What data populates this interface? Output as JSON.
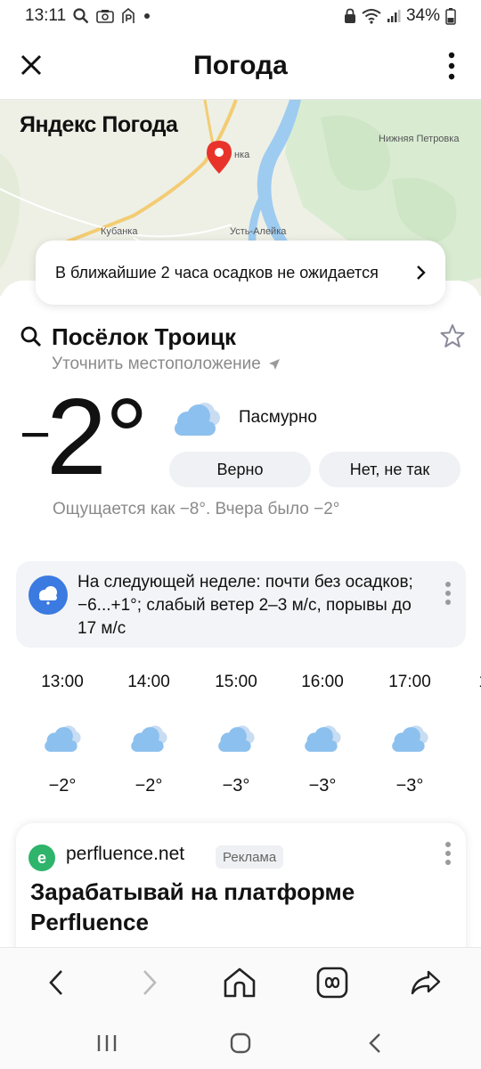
{
  "status": {
    "time": "13:11",
    "battery": "34%",
    "icons": [
      "search-icon",
      "screenshot-icon",
      "parking-icon",
      "dot-icon",
      "lock-icon",
      "wifi-icon",
      "signal-icon",
      "battery-icon"
    ]
  },
  "header": {
    "title": "Погода"
  },
  "map": {
    "brand": "Яндекс Погода",
    "labels": [
      "нка",
      "Нижняя Петровка",
      "Кубанка",
      "Усть-Алейка"
    ]
  },
  "precip": {
    "text": "В ближайшие 2 часа осадков не ожидается"
  },
  "location": {
    "name": "Посёлок Троицк",
    "refine": "Уточнить местоположение"
  },
  "current": {
    "temperature": "2°",
    "sign": "−",
    "condition": "Пасмурно",
    "correct_label": "Верно",
    "incorrect_label": "Нет, не так",
    "feels_like": "Ощущается как −8°. Вчера было −2°"
  },
  "forecast": {
    "text": "На следующей неделе: почти без осадков; −6...+1°; слабый ветер 2–3 м/с, порывы до 17 м/с"
  },
  "hourly": [
    {
      "time": "13:00",
      "temp": "−2°",
      "icon": "cloudy-icon"
    },
    {
      "time": "14:00",
      "temp": "−2°",
      "icon": "cloudy-icon"
    },
    {
      "time": "15:00",
      "temp": "−3°",
      "icon": "cloudy-icon"
    },
    {
      "time": "16:00",
      "temp": "−3°",
      "icon": "cloudy-icon"
    },
    {
      "time": "17:00",
      "temp": "−3°",
      "icon": "cloudy-icon"
    },
    {
      "time": "1",
      "temp": "",
      "icon": ""
    }
  ],
  "ad": {
    "logo": "e",
    "domain": "perfluence.net",
    "badge": "Реклама",
    "title": "Зарабатывай на платформе Perfluence"
  },
  "colors": {
    "accent_blue": "#3b7ae0",
    "pin_red": "#e8332b",
    "river_blue": "#9ecbf0",
    "cloud_blue": "#8cc0ee"
  }
}
